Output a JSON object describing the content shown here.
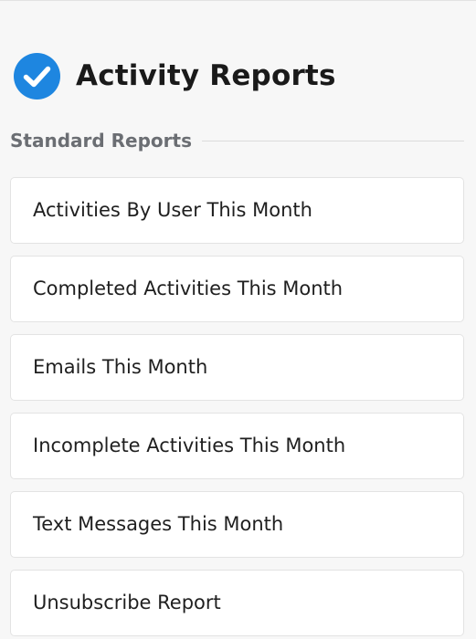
{
  "header": {
    "title": "Activity Reports",
    "icon": "check-circle-icon",
    "accent_color": "#1e86e0"
  },
  "section": {
    "title": "Standard Reports"
  },
  "reports": [
    {
      "label": "Activities By User This Month"
    },
    {
      "label": "Completed Activities This Month"
    },
    {
      "label": "Emails This Month"
    },
    {
      "label": "Incomplete Activities This Month"
    },
    {
      "label": "Text Messages This Month"
    },
    {
      "label": "Unsubscribe Report"
    }
  ]
}
